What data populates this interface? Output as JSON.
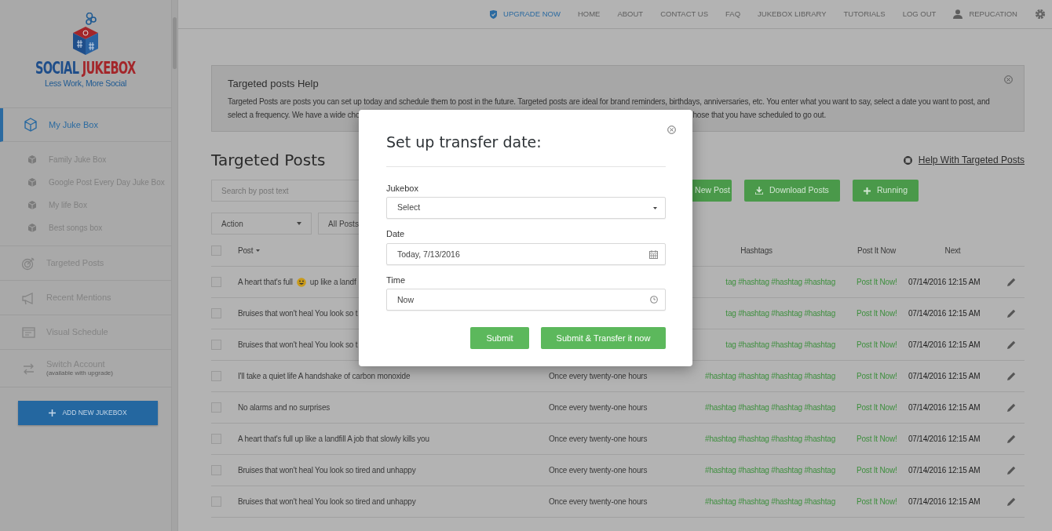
{
  "nav": {
    "items": [
      {
        "label": "UPGRADE NOW",
        "kind": "upgrade"
      },
      {
        "label": "HOME",
        "kind": "link"
      },
      {
        "label": "ABOUT",
        "kind": "link"
      },
      {
        "label": "CONTACT US",
        "kind": "link"
      },
      {
        "label": "FAQ",
        "kind": "link"
      },
      {
        "label": "JUKEBOX LIBRARY",
        "kind": "link"
      },
      {
        "label": "TUTORIALS",
        "kind": "link"
      },
      {
        "label": "LOG OUT",
        "kind": "link"
      },
      {
        "label": "REPUCATION",
        "kind": "user"
      }
    ]
  },
  "sidebar": {
    "logo": {
      "word_1": "SOCIAL",
      "word_2": "JUKEBOX",
      "tagline": "Less Work, More Social"
    },
    "items": [
      {
        "label": "My Juke Box",
        "selected": true,
        "children": [
          {
            "label": "Family Juke Box",
            "selected": false
          },
          {
            "label": "Google Post Every Day Juke Box",
            "selected": false
          },
          {
            "label": "My life Box",
            "selected": false
          },
          {
            "label": "Best songs box",
            "selected": false
          }
        ]
      },
      {
        "label": "Targeted Posts",
        "selected": false
      },
      {
        "label": "Recent Mentions",
        "selected": false
      },
      {
        "label": "Visual Schedule",
        "selected": false
      },
      {
        "label": "Switch Account",
        "note": "(available with upgrade)",
        "selected": false
      }
    ],
    "add_button": "ADD NEW JUKEBOX"
  },
  "help": {
    "title": "Targeted posts Help",
    "line_1": "Targeted Posts are posts you can set up today and schedule them to post in the future. Targeted posts are ideal for brand reminders, birthdays, anniversaries, etc. You enter what you want to say, select a date you want to post, and",
    "line_2_start": "select a frequency. We have a wide cho",
    "line_2_end": "hose that you have scheduled to go out."
  },
  "page_title": "Targeted Posts",
  "help_link": "Help With Targeted Posts",
  "search": {
    "placeholder": "Search by post text"
  },
  "filters": [
    {
      "label": "Action"
    },
    {
      "label": "All Posts"
    }
  ],
  "buttons": [
    {
      "label": "New Post",
      "kind": "plain"
    },
    {
      "label": "Download Posts",
      "kind": "download"
    },
    {
      "label": "Running",
      "kind": "add"
    }
  ],
  "table": {
    "select_all": {
      "checked": false
    },
    "columns": [
      {
        "label": "Post",
        "kind": "post"
      },
      {
        "label": "Hashtags",
        "kind": "hashtags"
      },
      {
        "label": "Post It Now",
        "kind": "action"
      },
      {
        "label": "Next",
        "kind": "date"
      }
    ],
    "rows": [
      {
        "selected": false,
        "post": "A heart that's full",
        "emoji": true,
        "post_after": "up like a landf",
        "hashtags": "tag #hashtag #hashtag #hashtag",
        "action": "Post It Now!",
        "next": "07/14/2016 12:15 AM"
      },
      {
        "selected": false,
        "post": "Bruises that won't heal You look so t",
        "hashtags": "tag #hashtag #hashtag #hashtag",
        "action": "Post It Now!",
        "next": "07/14/2016 12:15 AM"
      },
      {
        "selected": false,
        "post": "Bruises that won't heal You look so t",
        "hashtags": "tag #hashtag #hashtag #hashtag",
        "action": "Post It Now!",
        "next": "07/14/2016 12:15 AM"
      },
      {
        "selected": false,
        "post": "I'll take a quiet life A handshake of carbon monoxide",
        "frequency": "Once every twenty-one hours",
        "hashtags": "#hashtag #hashtag #hashtag #hashtag",
        "action": "Post It Now!",
        "next": "07/14/2016 12:15 AM"
      },
      {
        "selected": false,
        "post": "No alarms and no surprises",
        "frequency": "Once every twenty-one hours",
        "hashtags": "#hashtag #hashtag #hashtag #hashtag",
        "action": "Post It Now!",
        "next": "07/14/2016 12:15 AM"
      },
      {
        "selected": false,
        "post": "A heart that's full up like a landfill A job that slowly kills you",
        "frequency": "Once every twenty-one hours",
        "hashtags": "#hashtag #hashtag #hashtag #hashtag",
        "action": "Post It Now!",
        "next": "07/14/2016 12:15 AM"
      },
      {
        "selected": false,
        "post": "Bruises that won't heal You look so tired and unhappy",
        "frequency": "Once every twenty-one hours",
        "hashtags": "#hashtag #hashtag #hashtag #hashtag",
        "action": "Post It Now!",
        "next": "07/14/2016 12:15 AM"
      },
      {
        "selected": false,
        "post": "Bruises that won't heal You look so tired and unhappy",
        "frequency": "Once every twenty-one hours",
        "hashtags": "#hashtag #hashtag #hashtag #hashtag",
        "action": "Post It Now!",
        "next": "07/14/2016 12:15 AM"
      }
    ]
  },
  "modal": {
    "title": "Set up transfer date:",
    "fields": [
      {
        "label": "Jukebox",
        "value": "Select",
        "kind": "select"
      },
      {
        "label": "Date",
        "value": "Today, 7/13/2016",
        "kind": "date"
      },
      {
        "label": "Time",
        "value": "Now",
        "kind": "time"
      }
    ],
    "buttons": [
      "Submit",
      "Submit & Transfer it now"
    ]
  }
}
